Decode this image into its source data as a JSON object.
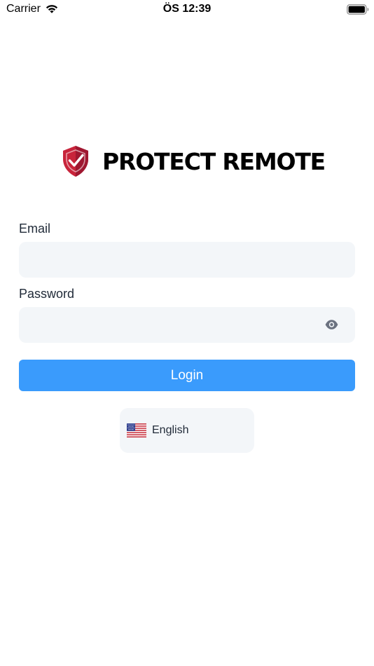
{
  "status_bar": {
    "carrier": "Carrier",
    "time": "ÖS 12:39",
    "wifi_icon": "wifi-icon",
    "battery_icon": "battery-full-icon"
  },
  "brand": {
    "logo_icon": "shield-check-icon",
    "name": "PROTECT REMOTE",
    "logo_color": "#c8243b"
  },
  "form": {
    "email_label": "Email",
    "email_value": "",
    "password_label": "Password",
    "password_value": "",
    "password_toggle_icon": "eye-icon",
    "login_label": "Login"
  },
  "language": {
    "flag_icon": "us-flag-icon",
    "selected": "English"
  },
  "colors": {
    "primary": "#3a9bfc",
    "field_background": "#f3f6f9",
    "text": "#1f2937"
  }
}
